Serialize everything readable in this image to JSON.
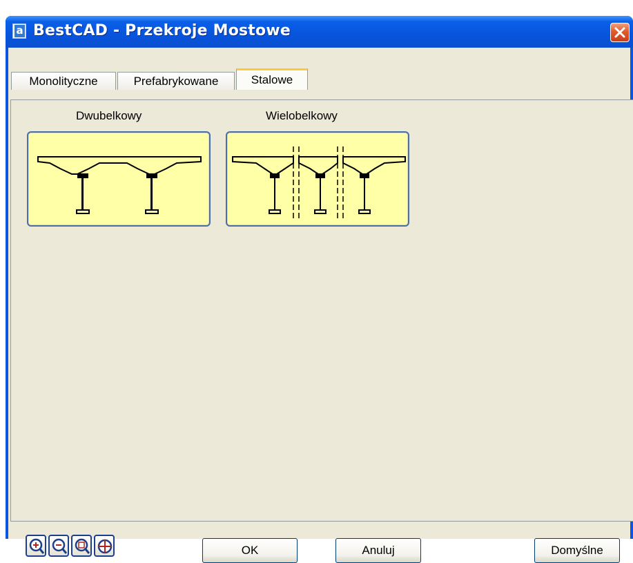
{
  "window": {
    "title": "BestCAD - Przekroje Mostowe",
    "app_icon_letter": "a"
  },
  "tabs": [
    {
      "label": "Monolityczne"
    },
    {
      "label": "Prefabrykowane"
    },
    {
      "label": "Stalowe",
      "active": true
    }
  ],
  "sections": [
    {
      "label": "Dwubelkowy"
    },
    {
      "label": "Wielobelkowy"
    }
  ],
  "toolbar": {
    "icons": [
      "zoom-in-icon",
      "zoom-out-icon",
      "zoom-extents-icon",
      "pan-icon"
    ]
  },
  "buttons": {
    "ok": "OK",
    "cancel": "Anuluj",
    "defaults": "Domyślne"
  },
  "colors": {
    "preview_bg": "#ffffa8",
    "accent_tab": "#ffc83c",
    "titlebar": "#0854dc"
  }
}
